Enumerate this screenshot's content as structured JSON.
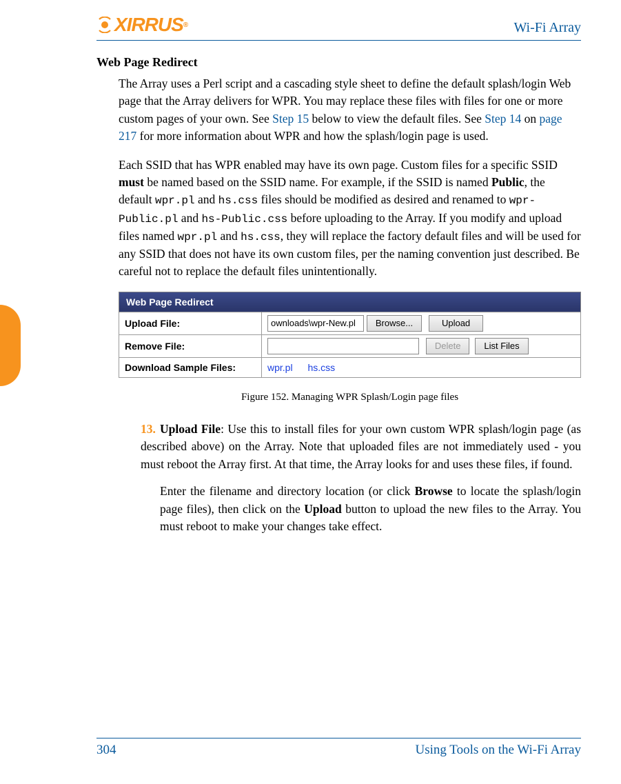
{
  "header": {
    "logo_text": "XIRRUS",
    "logo_sup": "®",
    "doc_title": "Wi-Fi Array"
  },
  "section_heading": "Web Page Redirect",
  "para1": {
    "pre": "The Array uses a Perl script and a cascading style sheet to define the default splash/login Web page that the Array delivers for WPR. You may replace these files with files for one or more custom pages of your own. See ",
    "link1": "Step 15",
    "mid1": " below to view the default files. See ",
    "link2": "Step 14",
    "mid2": " on ",
    "link3": "page 217",
    "post": " for more information about WPR and how the splash/login page is used."
  },
  "para2": {
    "t1": "Each SSID that has WPR enabled may have its own page. Custom files for a specific SSID ",
    "b1": "must",
    "t2": " be named based on the SSID name. For example, if the SSID is named ",
    "b2": "Public",
    "t3": ", the default ",
    "c1": "wpr.pl",
    "t4": " and ",
    "c2": "hs.css",
    "t5": " files should be modified as desired and renamed to ",
    "c3": "wpr-Public.pl",
    "t6": " and ",
    "c4": "hs-Public.css",
    "t7": " before uploading to the Array. If you modify and upload files named ",
    "c5": "wpr.pl",
    "t8": " and ",
    "c6": "hs.css",
    "t9": ", they will replace the factory default files and will be used for any SSID that does not have its own custom files, per the naming convention just described. Be careful not to replace the default files unintentionally."
  },
  "figure": {
    "header": "Web Page Redirect",
    "row1_label": "Upload File:",
    "row1_input": "ownloads\\wpr-New.pl",
    "browse_btn": "Browse...",
    "upload_btn": "Upload",
    "row2_label": "Remove File:",
    "row2_input": "",
    "delete_btn": "Delete",
    "list_btn": "List Files",
    "row3_label": "Download Sample Files:",
    "dl1": "wpr.pl",
    "dl2": "hs.css",
    "caption": "Figure 152. Managing WPR Splash/Login page files"
  },
  "item13": {
    "marker": "13.",
    "b1": "Upload File",
    "t1": ": Use this to install files for your own custom WPR splash/login page (as described above) on the Array. Note that uploaded files are not immediately used - you must reboot the Array first. At that time, the Array looks for and uses these files, if found.",
    "t2a": "Enter the filename and directory location (or click ",
    "b2": "Browse",
    "t2b": " to locate the splash/login page files), then click on the ",
    "b3": "Upload",
    "t2c": " button to upload the new files to the Array. You must reboot to make your changes take effect."
  },
  "footer": {
    "page_num": "304",
    "chapter": "Using Tools on the Wi-Fi Array"
  }
}
